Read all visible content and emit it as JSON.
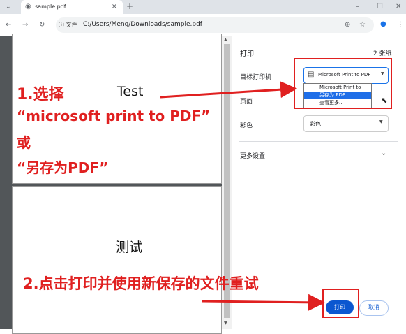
{
  "browser": {
    "tab_title": "sample.pdf",
    "address_chip": "文件",
    "url": "C:/Users/Meng/Downloads/sample.pdf",
    "new_tab": "+",
    "window_controls": [
      "–",
      "☐",
      "✕"
    ]
  },
  "document": {
    "page1_text": "Test",
    "page2_text": "测试"
  },
  "print_panel": {
    "title": "打印",
    "sheet_count": "2 张纸",
    "destination_label": "目标打印机",
    "destination_value": "Microsoft Print to PDF",
    "destination_options": [
      "Microsoft Print to PDF",
      "另存为 PDF",
      "查看更多..."
    ],
    "selected_option_index": 1,
    "pages_label": "页面",
    "color_label": "彩色",
    "color_value": "彩色",
    "more_settings": "更多设置",
    "print_button": "打印",
    "cancel_button": "取消"
  },
  "annotations": {
    "step1_line1": "1.选择",
    "step1_line2": "“microsoft print to PDF”",
    "step1_line3": "或",
    "step1_line4": "“另存为PDF”",
    "step2": "2.点击打印并使用新保存的文件重试"
  },
  "colors": {
    "accent": "#0b57d0",
    "annotation_red": "#e02020",
    "viewer_bg": "#525659"
  }
}
